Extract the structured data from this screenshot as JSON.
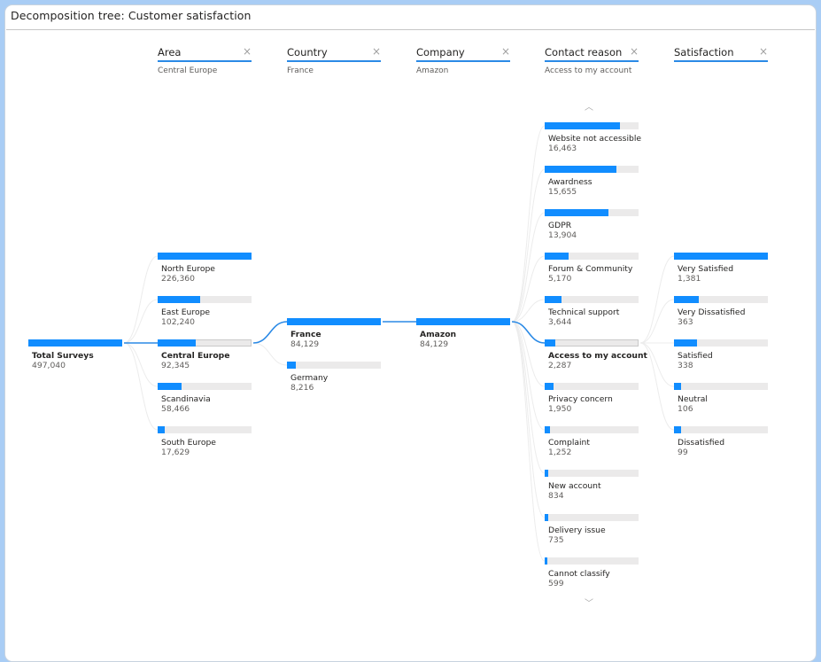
{
  "title": "Decomposition tree: Customer satisfaction",
  "colors": {
    "accent": "#118dff",
    "track": "#ebeaea",
    "header_rule": "#2b8ae6"
  },
  "root": {
    "label": "Total Surveys",
    "value": "497,040",
    "fraction": 1.0
  },
  "columns": [
    {
      "header": "Area",
      "filter": "Central Europe",
      "nodes": [
        {
          "label": "North Europe",
          "value": "226,360",
          "fraction": 1.0
        },
        {
          "label": "East Europe",
          "value": "102,240",
          "fraction": 0.452
        },
        {
          "label": "Central Europe",
          "value": "92,345",
          "fraction": 0.408,
          "selected": true
        },
        {
          "label": "Scandinavia",
          "value": "58,466",
          "fraction": 0.258
        },
        {
          "label": "South Europe",
          "value": "17,629",
          "fraction": 0.078
        }
      ]
    },
    {
      "header": "Country",
      "filter": "France",
      "nodes": [
        {
          "label": "France",
          "value": "84,129",
          "fraction": 1.0,
          "selected": true
        },
        {
          "label": "Germany",
          "value": "8,216",
          "fraction": 0.098
        }
      ]
    },
    {
      "header": "Company",
      "filter": "Amazon",
      "nodes": [
        {
          "label": "Amazon",
          "value": "84,129",
          "fraction": 1.0,
          "selected": true
        }
      ]
    },
    {
      "header": "Contact reason",
      "filter": "Access to my account",
      "nodes": [
        {
          "label": "Website not accessible",
          "value": "16,463",
          "fraction": 0.8
        },
        {
          "label": "Awardness",
          "value": "15,655",
          "fraction": 0.76
        },
        {
          "label": "GDPR",
          "value": "13,904",
          "fraction": 0.68
        },
        {
          "label": "Forum & Community",
          "value": "5,170",
          "fraction": 0.25
        },
        {
          "label": "Technical support",
          "value": "3,644",
          "fraction": 0.18
        },
        {
          "label": "Access to my account",
          "value": "2,287",
          "fraction": 0.11,
          "selected": true
        },
        {
          "label": "Privacy concern",
          "value": "1,950",
          "fraction": 0.095
        },
        {
          "label": "Complaint",
          "value": "1,252",
          "fraction": 0.061
        },
        {
          "label": "New account",
          "value": "834",
          "fraction": 0.041
        },
        {
          "label": "Delivery issue",
          "value": "735",
          "fraction": 0.036
        },
        {
          "label": "Cannot classify",
          "value": "599",
          "fraction": 0.029
        }
      ]
    },
    {
      "header": "Satisfaction",
      "filter": "",
      "nodes": [
        {
          "label": "Very Satisfied",
          "value": "1,381",
          "fraction": 1.0
        },
        {
          "label": "Very Dissatisfied",
          "value": "363",
          "fraction": 0.263
        },
        {
          "label": "Satisfied",
          "value": "338",
          "fraction": 0.245
        },
        {
          "label": "Neutral",
          "value": "106",
          "fraction": 0.077
        },
        {
          "label": "Dissatisfied",
          "value": "99",
          "fraction": 0.072
        }
      ]
    }
  ],
  "icons": {
    "close": "×",
    "scroll_up": "︿",
    "scroll_down": "﹀"
  }
}
